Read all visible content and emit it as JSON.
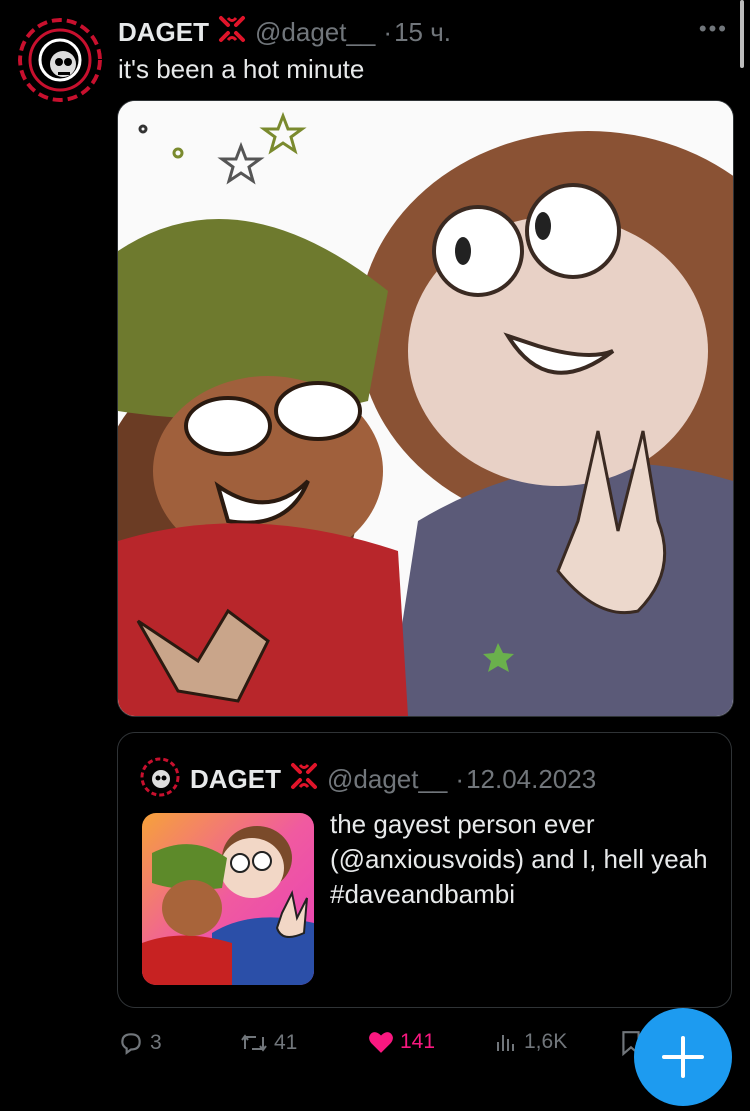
{
  "tweet": {
    "author_name": "DAGET",
    "handle": "@daget__",
    "separator": "·",
    "time": "15 ч.",
    "text": "it's been a hot minute",
    "more": "•••"
  },
  "quote": {
    "author_name": "DAGET",
    "handle": "@daget__",
    "separator": "·",
    "date": "12.04.2023",
    "text": "the gayest person ever (@anxiousvoids) and I, hell yeah #daveandbambi"
  },
  "actions": {
    "replies": "3",
    "retweets": "41",
    "likes": "141",
    "views": "1,6K"
  },
  "colors": {
    "accent": "#1d9bf0",
    "like": "#f91880",
    "muted": "#71767b",
    "brand_red": "#e0142a"
  },
  "icons": [
    "reply-icon",
    "retweet-icon",
    "heart-icon",
    "views-icon",
    "bookmark-icon",
    "share-icon",
    "compose-plus-icon",
    "anger-badge-icon"
  ]
}
